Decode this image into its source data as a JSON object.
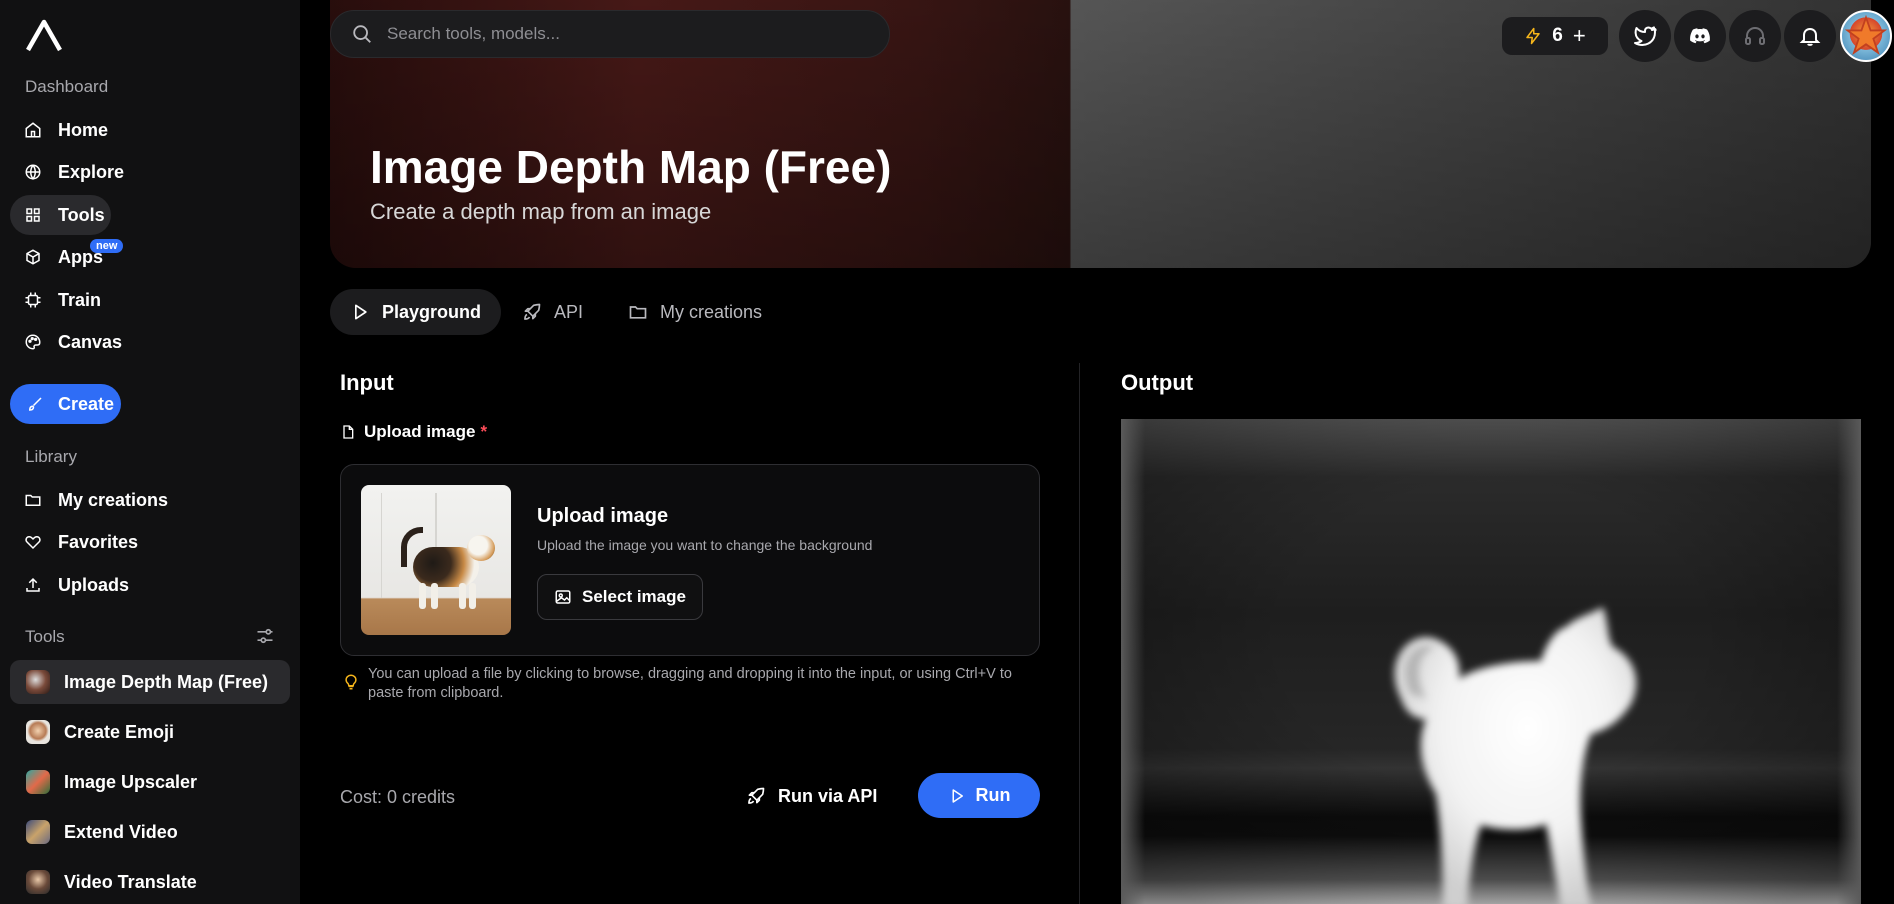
{
  "sidebar": {
    "dashboard_label": "Dashboard",
    "nav": [
      {
        "label": "Home",
        "icon": "home-icon"
      },
      {
        "label": "Explore",
        "icon": "globe-icon"
      },
      {
        "label": "Tools",
        "icon": "grid-icon"
      },
      {
        "label": "Apps",
        "icon": "box-icon",
        "badge": "new"
      },
      {
        "label": "Train",
        "icon": "chip-icon"
      },
      {
        "label": "Canvas",
        "icon": "palette-icon"
      }
    ],
    "create_label": "Create",
    "library_label": "Library",
    "library": [
      {
        "label": "My creations",
        "icon": "folder-icon"
      },
      {
        "label": "Favorites",
        "icon": "heart-icon"
      },
      {
        "label": "Uploads",
        "icon": "upload-icon"
      }
    ],
    "tools_label": "Tools",
    "tools": [
      {
        "label": "Image Depth Map (Free)"
      },
      {
        "label": "Create Emoji"
      },
      {
        "label": "Image Upscaler"
      },
      {
        "label": "Extend Video"
      },
      {
        "label": "Video Translate"
      }
    ]
  },
  "header": {
    "search_placeholder": "Search tools, models...",
    "credits": "6",
    "credits_add": "+"
  },
  "hero": {
    "title": "Image Depth Map (Free)",
    "subtitle": "Create a depth map from an image"
  },
  "tabs": [
    {
      "label": "Playground"
    },
    {
      "label": "API"
    },
    {
      "label": "My creations"
    }
  ],
  "input": {
    "heading": "Input",
    "field_label": "Upload image",
    "required_mark": "*",
    "upload_title": "Upload image",
    "upload_desc": "Upload the image you want to change the background",
    "select_label": "Select image",
    "hint": "You can upload a file by clicking to browse, dragging and dropping it into the input, or using Ctrl+V to paste from clipboard.",
    "cost": "Cost: 0 credits",
    "run_api_label": "Run via API",
    "run_label": "Run"
  },
  "output": {
    "heading": "Output"
  },
  "colors": {
    "accent": "#2f6df6",
    "sidebar_bg": "#111112",
    "required": "#ff4d5a",
    "credit_bolt": "#f5b51b"
  }
}
